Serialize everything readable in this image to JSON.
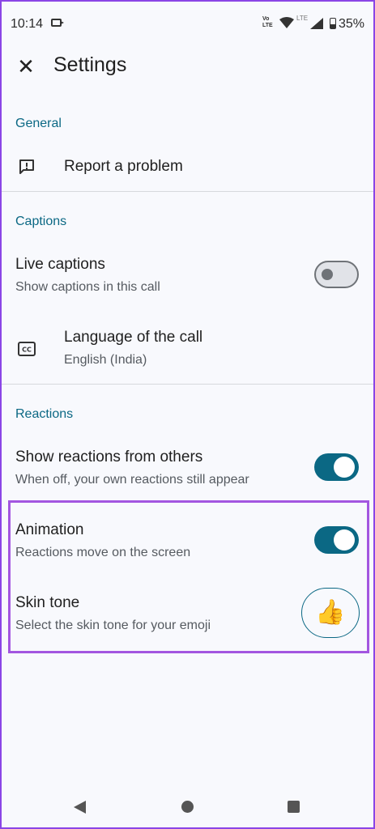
{
  "status_bar": {
    "time": "10:14",
    "volte": "Vo\nLTE",
    "lte": "LTE",
    "battery": "35%"
  },
  "app_bar": {
    "close_icon": "close-icon",
    "title": "Settings"
  },
  "sections": {
    "general": {
      "header": "General",
      "report": {
        "icon": "feedback-icon",
        "title": "Report a problem"
      }
    },
    "captions": {
      "header": "Captions",
      "live_captions": {
        "title": "Live captions",
        "subtitle": "Show captions in this call",
        "enabled": false
      },
      "language": {
        "icon": "closed-caption-icon",
        "title": "Language of the call",
        "subtitle": "English (India)"
      }
    },
    "reactions": {
      "header": "Reactions",
      "show_reactions": {
        "title": "Show reactions from others",
        "subtitle": "When off, your own reactions still appear",
        "enabled": true
      },
      "animation": {
        "title": "Animation",
        "subtitle": "Reactions move on the screen",
        "enabled": true
      },
      "skin_tone": {
        "title": "Skin tone",
        "subtitle": "Select the skin tone for your emoji",
        "emoji": "👍"
      }
    }
  },
  "colors": {
    "accent": "#0b6884",
    "highlight": "#a356e0",
    "background": "#f8f9fd"
  },
  "nav_bar": {
    "back": "back-icon",
    "home": "home-icon",
    "recents": "recents-icon"
  }
}
